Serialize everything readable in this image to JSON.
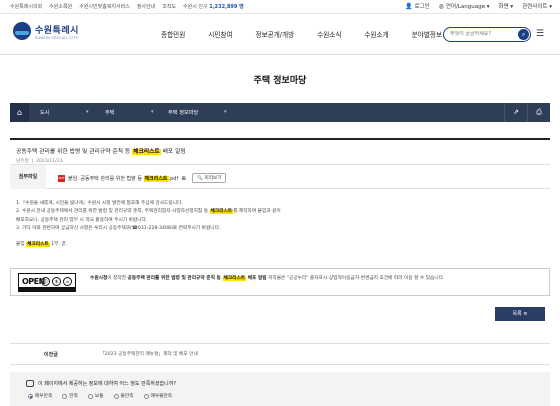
{
  "utility": {
    "links": [
      "수원특례시의회",
      "수원소록원",
      "수원시민맞춤복지서비스",
      "정사안내",
      "조직도"
    ],
    "population_label": "수원시 인구",
    "population_value": "1,232,899 명",
    "login": "로그인",
    "language": "언어/Language",
    "screen": "화면",
    "related": "관련사이트"
  },
  "header": {
    "logo_name": "수원특례시",
    "logo_sub": "SUWON SPECIAL CITY",
    "nav": [
      "종합민원",
      "시민참여",
      "정보공개/개방",
      "수원소식",
      "수원소개",
      "분야별정보"
    ],
    "search_placeholder": "무엇이 궁금하세요?"
  },
  "page": {
    "title": "주택 정보마당"
  },
  "breadcrumb": {
    "items": [
      "도시",
      "주택",
      "주택 정보마당"
    ]
  },
  "article": {
    "title_pre": "공동주택 관리를 위한 법령 및 관리규약 준칙 등 ",
    "title_hl": "체크리스트",
    "title_post": " 배포 알림",
    "author": "남유정",
    "date": "2023/11/23",
    "attach_label": "첨부파일",
    "file_pre": "붙임. 공동주택 관리를 위한 법령 등 ",
    "file_hl": "체크리스트",
    "file_post": ".pdf",
    "preview": "미리보기",
    "line1": "1.『수원을 새롭게, 시민을 빛나게』수원시 시정 발전에 협조해 주심에 감사드립니다.",
    "line2_pre": "2. 수원시 관내 공동주택에서 관리를 위한 법령 및 관리규약 준칙, 주택관리업자 사업자선정지침 등 ",
    "line2_hl": "체크리스트",
    "line2_post": "를 제작하여 붙임과 같이",
    "line3": "   배포하오니, 공동주택 관리 업무 시 적극 활용하여 주시기 바랍니다.",
    "line4": "3. 기타 이와 관련하여 궁금하신 사항은 우리시 공동주택과(☎031-228-3408)로 연락주시기 바랍니다.",
    "attach_line_pre": "붙임 ",
    "attach_line_hl": "체크리스트",
    "attach_line_post": " 1부. 끝."
  },
  "license": {
    "badge": "OPEN",
    "text_org": "수원시청",
    "text_mid": "이 창작한 ",
    "text_work_pre": "공동주택 관리를 위한 법령 및 관리규약 준칙 등 ",
    "text_work_hl": "체크리스트",
    "text_work_post": " 배포 알림",
    "text_tail": " 저작물은 \"공공누리\" 출처표시-상업적이용금지-변경금지 조건에 따라 이용 할 수 있습니다."
  },
  "list_button": "목록  ≡",
  "prevnext": {
    "label": "이전글",
    "title": "「2023 공동주택관리 매뉴얼」제작 및 배포 안내"
  },
  "survey": {
    "question": "이 페이지에서 제공하는 정보에 대하여 어느 정도 만족하셨습니까?",
    "options": [
      "매우만족",
      "만족",
      "보통",
      "불만족",
      "매우불만족"
    ],
    "selected_index": 0
  },
  "colors": {
    "brand": "#1d3f84",
    "breadcrumb_bg": "#2f3e57",
    "highlight": "#ffe400",
    "list_button": "#2a3d66"
  }
}
